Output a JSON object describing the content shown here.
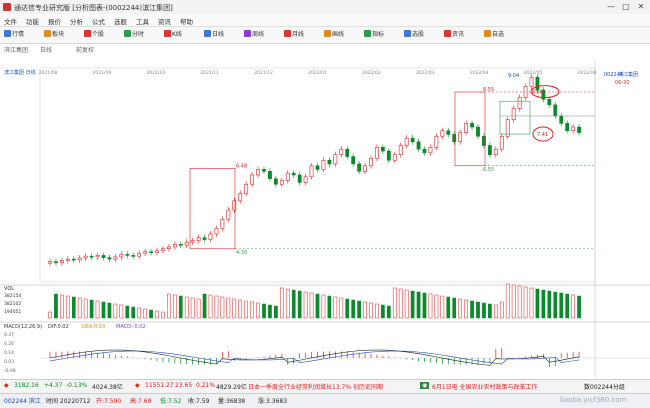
{
  "window": {
    "title": "通达信专业研究版 [分析图表-(0002244)滨江集团]",
    "min": "—",
    "max": "□",
    "close": "✕"
  },
  "menu": [
    "文件",
    "功能",
    "报价",
    "分析",
    "公式",
    "选股",
    "工具",
    "资讯",
    "帮助"
  ],
  "toolbar": [
    {
      "label": "行情",
      "icon_color": "#3a7bd5"
    },
    {
      "label": "板块",
      "icon_color": "#e08a1a"
    },
    {
      "label": "个股",
      "icon_color": "#d33"
    },
    {
      "label": "分时",
      "icon_color": "#2a9d4a"
    },
    {
      "label": "K线",
      "icon_color": "#d33"
    },
    {
      "label": "日线",
      "icon_color": "#3a7bd5"
    },
    {
      "label": "周线",
      "icon_color": "#8a3ad5"
    },
    {
      "label": "月线",
      "icon_color": "#d33"
    },
    {
      "label": "画线",
      "icon_color": "#e08a1a"
    },
    {
      "label": "指标",
      "icon_color": "#2a9d4a"
    },
    {
      "label": "选股",
      "icon_color": "#3a7bd5"
    },
    {
      "label": "资讯",
      "icon_color": "#d33"
    },
    {
      "label": "自选",
      "icon_color": "#e08a1a"
    }
  ],
  "tabs": [
    "滨江集团",
    "日线",
    "前复权"
  ],
  "chart_data": {
    "type": "candlestick",
    "title": "滨江集团 日线",
    "x_dates": [
      "2021/08",
      "2021/09",
      "2021/10",
      "2021/11",
      "2021/12",
      "2022/01",
      "2022/02",
      "2022/03",
      "2022/04",
      "2022/05",
      "2022/06"
    ],
    "ylim": [
      3.4,
      9.2
    ],
    "price_levels": [
      {
        "value": 8.56,
        "label": "8.56"
      },
      {
        "value": 7.41,
        "label": "7.41"
      },
      {
        "value": 8.55,
        "label": "8.55"
      },
      {
        "value": 6.55,
        "label": "6.55"
      },
      {
        "value": 6.48,
        "label": "6.48"
      },
      {
        "value": 4.3,
        "label": "4.30"
      },
      {
        "value": 9.04,
        "label": "9.04"
      }
    ],
    "closes": [
      3.95,
      3.92,
      3.98,
      4.02,
      4.0,
      4.05,
      4.1,
      4.08,
      4.12,
      4.06,
      4.02,
      4.08,
      4.15,
      4.12,
      4.1,
      4.18,
      4.22,
      4.2,
      4.25,
      4.3,
      4.35,
      4.42,
      4.4,
      4.48,
      4.52,
      4.6,
      4.55,
      4.7,
      4.85,
      5.1,
      5.35,
      5.6,
      5.8,
      6.05,
      6.3,
      6.45,
      6.4,
      6.2,
      6.05,
      6.15,
      6.35,
      6.3,
      6.1,
      6.25,
      6.55,
      6.45,
      6.7,
      6.6,
      6.85,
      7.0,
      6.8,
      6.6,
      6.4,
      6.55,
      6.75,
      7.05,
      6.95,
      6.7,
      6.85,
      7.1,
      7.3,
      7.2,
      7.0,
      6.9,
      7.05,
      7.35,
      7.5,
      7.4,
      7.2,
      7.45,
      7.7,
      7.6,
      7.35,
      7.1,
      6.85,
      7.0,
      7.35,
      7.8,
      8.1,
      8.4,
      8.7,
      8.95,
      8.6,
      8.35,
      8.2,
      7.9,
      7.7,
      7.5,
      7.6,
      7.45
    ],
    "volume_label": "VOL",
    "volume_values": [
      "382154",
      "382102",
      "194051"
    ],
    "macd": {
      "title": "MACD(12,26,9)",
      "dif": "DIF:0.02",
      "dea": "DEA:0.03",
      "macd": "MACD:-0.02",
      "ticks": [
        "0.37",
        "0.26",
        "0.14",
        "0.03",
        "-0.08"
      ]
    },
    "right_labels": {
      "code": "002244",
      "date": "06-30",
      "name": "滨江集团"
    }
  },
  "bottombar": {
    "index1": "3182.16",
    "chg1": "+4.37",
    "pct1": "-0.13%",
    "amt1": "4024.38亿",
    "index2": "11551.27",
    "chg2": "23.65",
    "pct2": "0.21%",
    "amt2": "4829.29亿",
    "news": "日本一季度全行业经常利润增长13.7% 创历史同期",
    "news2": "6月1日电 全国农业农村政策与改革工作",
    "right": "数002244分组"
  },
  "statusbar": {
    "code": "002244 滨江",
    "date": "时间 20220712",
    "open": "开:7.590",
    "high": "高:7.69",
    "low": "低:7.52",
    "close": "收:7.59",
    "vol": "量:36838",
    "chg": "涨:3.3683",
    "watermark": "liaoba.yicf360.com"
  }
}
